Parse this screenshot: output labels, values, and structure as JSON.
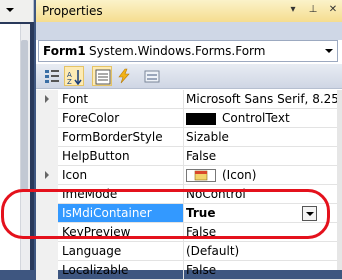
{
  "titlebar": {
    "title": "Properties",
    "pin_glyph": "▾",
    "pushpin_glyph": "⊥",
    "close_glyph": "✕"
  },
  "object_selector": {
    "name": "Form1",
    "type": "System.Windows.Forms.Form"
  },
  "toolbar": {
    "buttons": [
      {
        "icon": "categorized-icon"
      },
      {
        "icon": "alphabetical-icon",
        "active": true
      },
      {
        "icon": "properties-icon"
      },
      {
        "icon": "events-icon"
      },
      {
        "icon": "property-pages-icon"
      }
    ]
  },
  "properties": [
    {
      "name": "Font",
      "value": "Microsoft Sans Serif, 8.25",
      "expandable": true
    },
    {
      "name": "ForeColor",
      "value": "ControlText",
      "swatch": "#000000"
    },
    {
      "name": "FormBorderStyle",
      "value": "Sizable"
    },
    {
      "name": "HelpButton",
      "value": "False"
    },
    {
      "name": "Icon",
      "value": "(Icon)",
      "expandable": true,
      "has_icon": true
    },
    {
      "name": "ImeMode",
      "value": "NoControl"
    },
    {
      "name": "IsMdiContainer",
      "value": "True",
      "selected": true
    },
    {
      "name": "KeyPreview",
      "value": "False"
    },
    {
      "name": "Language",
      "value": "(Default)"
    },
    {
      "name": "Localizable",
      "value": "False"
    }
  ],
  "colors": {
    "selection": "#3399ff",
    "annotation": "#e4111c",
    "titlebar_top": "#fbf3c9",
    "titlebar_bottom": "#f5dd8f"
  }
}
